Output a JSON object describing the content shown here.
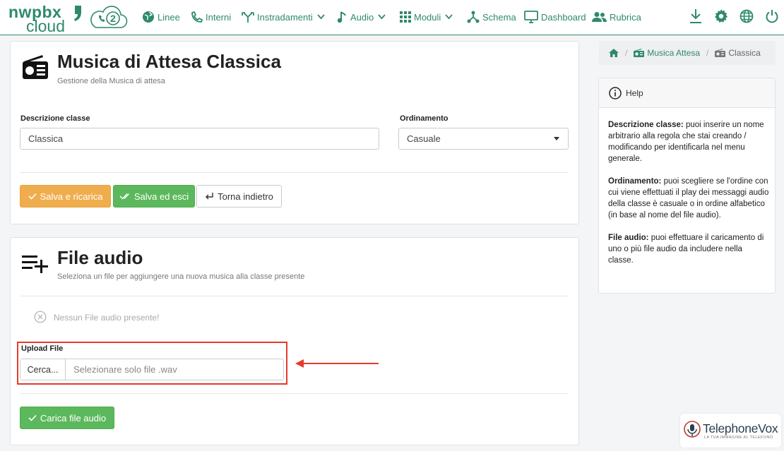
{
  "brand": {
    "logo_line1": "nwpbx",
    "logo_line2": "cloud",
    "logo_badge": "2"
  },
  "nav": {
    "items": [
      {
        "label": "Linee",
        "icon": "globe-icon"
      },
      {
        "label": "Interni",
        "icon": "phone-icon"
      },
      {
        "label": "Instradamenti",
        "icon": "routing-icon",
        "dropdown": true
      },
      {
        "label": "Audio",
        "icon": "music-note-icon",
        "dropdown": true
      },
      {
        "label": "Moduli",
        "icon": "grid-icon",
        "dropdown": true
      },
      {
        "label": "Schema",
        "icon": "schema-icon"
      },
      {
        "label": "Dashboard",
        "icon": "monitor-icon"
      },
      {
        "label": "Rubrica",
        "icon": "contacts-icon"
      }
    ],
    "right_icons": [
      "download-icon",
      "gear-icon",
      "globe-icon",
      "power-icon"
    ]
  },
  "class_card": {
    "title": "Musica di Attesa Classica",
    "subtitle": "Gestione della Musica di attesa",
    "description_label": "Descrizione classe",
    "description_value": "Classica",
    "ordering_label": "Ordinamento",
    "ordering_value": "Casuale",
    "btn_save_reload": "Salva e ricarica",
    "btn_save_exit": "Salva ed esci",
    "btn_back": "Torna indietro"
  },
  "audio_card": {
    "title": "File audio",
    "subtitle": "Seleziona un file per aggiungere una nuova musica alla classe presente",
    "empty_message": "Nessun File audio presente!",
    "upload_label": "Upload File",
    "browse_button": "Cerca...",
    "file_placeholder": "Selezionare solo file .wav",
    "upload_button": "Carica file audio"
  },
  "breadcrumb": {
    "parent": "Musica Attesa",
    "current": "Classica"
  },
  "help": {
    "title": "Help",
    "items": [
      {
        "term": "Descrizione classe:",
        "text": " puoi inserire un nome arbitrario alla regola che stai creando / modificando per identificarla nel menu generale."
      },
      {
        "term": "Ordinamento:",
        "text": " puoi scegliere se l'ordine con cui viene effettuati il play dei messaggi audio della classe è casuale o in ordine alfabetico (in base al nome del file audio)."
      },
      {
        "term": "File audio:",
        "text": " puoi effettuare il caricamento di uno o più file audio da includere nella classe."
      }
    ]
  },
  "watermark": {
    "name": "TelephoneVox",
    "tagline": "LA TUA IMMAGINE AL TELEFONO"
  },
  "colors": {
    "brand_green": "#2e8a6b",
    "btn_orange": "#f0ad4e",
    "btn_green": "#5cb85c",
    "highlight_red": "#e53a2a"
  }
}
